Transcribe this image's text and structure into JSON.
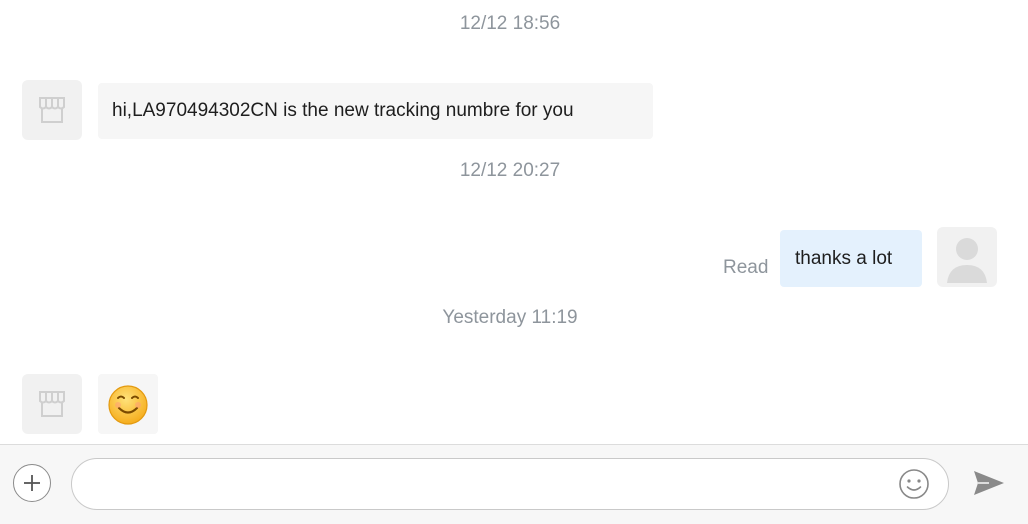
{
  "messages": [
    {
      "time": "12/12 18:56",
      "from": "shop",
      "text": "hi,LA970494302CN is the new tracking numbre for you"
    },
    {
      "time": "12/12 20:27",
      "from": "me",
      "text": "thanks a lot",
      "status": "Read"
    },
    {
      "time": "Yesterday 11:19",
      "from": "shop",
      "sticker": "smiling-face"
    }
  ],
  "composer": {
    "placeholder": ""
  },
  "colors": {
    "incoming_bubble": "#f6f6f6",
    "outgoing_bubble": "#e4f1fd",
    "timestamp_text": "#8e959c",
    "emoji_face": "#f5b51e"
  },
  "icons": {
    "shop_avatar": "storefront-icon",
    "user_avatar": "user-silhouette-icon",
    "attach": "plus-icon",
    "emoji": "smiley-icon",
    "send": "paper-plane-icon"
  }
}
